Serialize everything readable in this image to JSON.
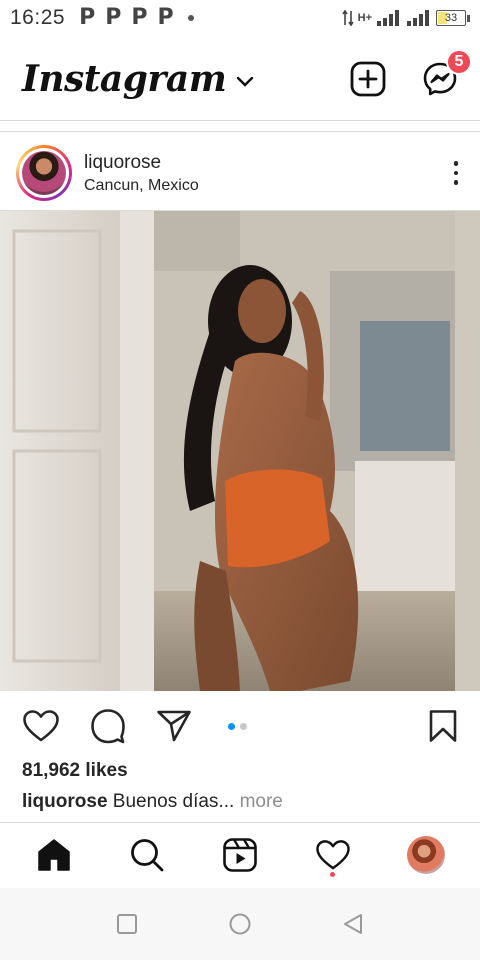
{
  "status_bar": {
    "time": "16:25",
    "notification_icons": [
      "P",
      "P",
      "P",
      "P"
    ],
    "network_label": "H+",
    "battery_level": "33"
  },
  "header": {
    "logo_text": "Instagram",
    "messenger_badge_count": "5"
  },
  "post": {
    "username": "liquorose",
    "location": "Cancun, Mexico",
    "likes_text": "81,962 likes",
    "caption_username": "liquorose",
    "caption_text": "Buenos días",
    "caption_ellipsis": "...",
    "more_label": "more",
    "carousel_count": 2,
    "carousel_active_index": 0
  },
  "icons": {
    "create": "plus-square-icon",
    "messenger": "messenger-icon",
    "like": "heart-icon",
    "comment": "comment-icon",
    "share": "paper-plane-icon",
    "save": "bookmark-icon",
    "home": "home-icon",
    "search": "search-icon",
    "reels": "reels-icon",
    "activity": "heart-icon",
    "profile": "profile-avatar"
  },
  "colors": {
    "badge": "#ed4956",
    "carousel_active": "#0095f6",
    "text_primary": "#262626",
    "text_muted": "#8e8e8e"
  }
}
